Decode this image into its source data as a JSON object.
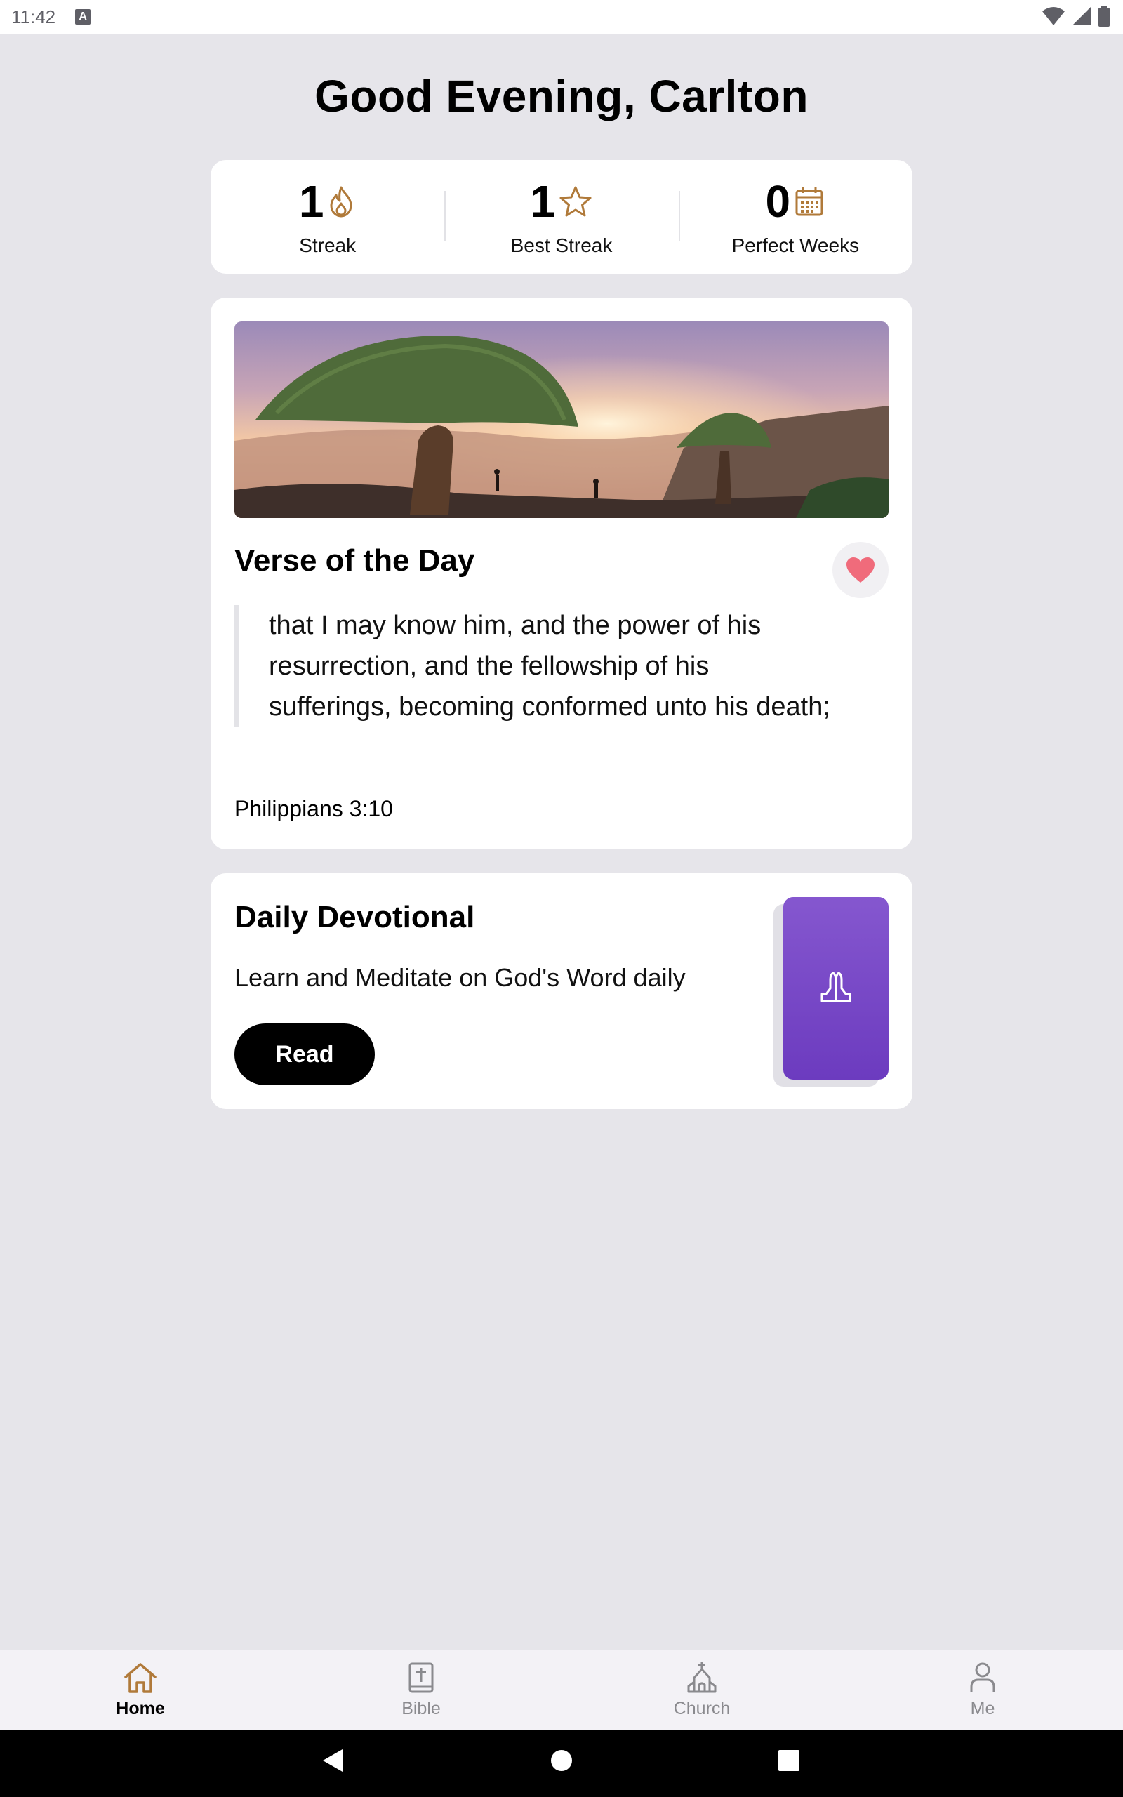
{
  "status_bar": {
    "time": "11:42",
    "a_icon_letter": "A"
  },
  "greeting": "Good Evening, Carlton",
  "stats": [
    {
      "value": "1",
      "label": "Streak",
      "icon": "flame-icon"
    },
    {
      "value": "1",
      "label": "Best Streak",
      "icon": "star-icon"
    },
    {
      "value": "0",
      "label": "Perfect Weeks",
      "icon": "calendar-icon"
    }
  ],
  "verse": {
    "title": "Verse of the Day",
    "text": "that I may know him, and the power of his resurrection, and the fellowship of his sufferings, becoming conformed unto his death;",
    "reference": "Philippians 3:10",
    "liked": true
  },
  "devotional": {
    "title": "Daily Devotional",
    "subtitle": "Learn and Meditate on God's Word daily",
    "button_label": "Read",
    "icon": "praying-hands-icon"
  },
  "nav": [
    {
      "label": "Home",
      "icon": "home-icon",
      "active": true
    },
    {
      "label": "Bible",
      "icon": "bible-icon",
      "active": false
    },
    {
      "label": "Church",
      "icon": "church-icon",
      "active": false
    },
    {
      "label": "Me",
      "icon": "person-icon",
      "active": false
    }
  ],
  "colors": {
    "accent": "#b07a3a",
    "background": "#e6e5ea",
    "devotional_purple": "#7546c8",
    "heart": "#f06b7b"
  }
}
